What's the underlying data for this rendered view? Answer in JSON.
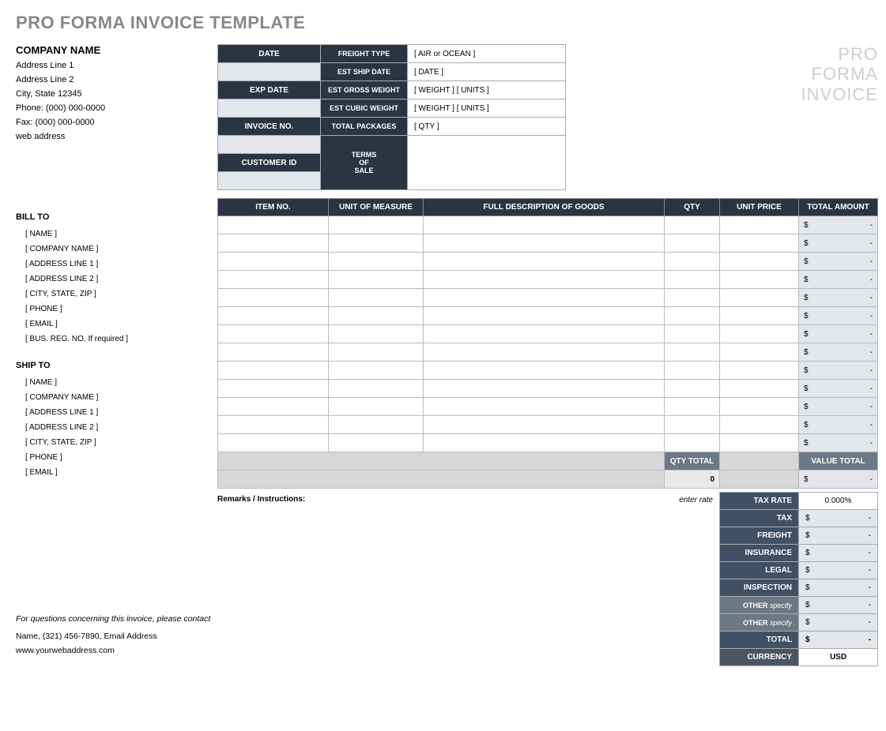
{
  "title": "PRO FORMA INVOICE TEMPLATE",
  "watermark": {
    "l1": "PRO",
    "l2": "FORMA",
    "l3": "INVOICE"
  },
  "company": {
    "name": "COMPANY NAME",
    "addr1": "Address Line 1",
    "addr2": "Address Line 2",
    "city": "City, State  12345",
    "phone": "Phone: (000) 000-0000",
    "fax": "Fax: (000) 000-0000",
    "web": "web address"
  },
  "info": {
    "date_lbl": "DATE",
    "freight_lbl": "FREIGHT TYPE",
    "freight_val": "[ AIR or OCEAN ]",
    "ship_lbl": "EST SHIP DATE",
    "ship_val": "[ DATE ]",
    "exp_lbl": "EXP DATE",
    "gross_lbl": "EST GROSS WEIGHT",
    "gross_val": "[ WEIGHT ]   [ UNITS ]",
    "cubic_lbl": "EST CUBIC WEIGHT",
    "cubic_val": "[ WEIGHT ]   [ UNITS ]",
    "inv_lbl": "INVOICE NO.",
    "pkg_lbl": "TOTAL PACKAGES",
    "pkg_val": "[ QTY ]",
    "cust_lbl": "CUSTOMER ID",
    "terms_l1": "TERMS",
    "terms_l2": "OF",
    "terms_l3": "SALE"
  },
  "billto": {
    "title": "BILL TO",
    "rows": [
      "[ NAME ]",
      "[ COMPANY NAME ]",
      "[ ADDRESS LINE 1 ]",
      "[ ADDRESS LINE 2 ]",
      "[ CITY, STATE, ZIP ]",
      "[ PHONE ]",
      "[ EMAIL ]",
      "[ BUS. REG. NO.  If required ]"
    ]
  },
  "shipto": {
    "title": "SHIP TO",
    "rows": [
      "[ NAME ]",
      "[ COMPANY NAME ]",
      "[ ADDRESS LINE 1 ]",
      "[ ADDRESS LINE 2 ]",
      "[ CITY, STATE, ZIP ]",
      "[ PHONE ]",
      "[ EMAIL ]"
    ]
  },
  "items_header": {
    "c1": "ITEM NO.",
    "c2": "UNIT OF MEASURE",
    "c3": "FULL DESCRIPTION OF GOODS",
    "c4": "QTY",
    "c5": "UNIT PRICE",
    "c6": "TOTAL AMOUNT"
  },
  "amt_cur": "$",
  "amt_dash": "-",
  "qty_total_lbl": "QTY TOTAL",
  "qty_total_val": "0",
  "value_total_lbl": "VALUE TOTAL",
  "remarks_lbl": "Remarks / Instructions:",
  "enter_rate": "enter rate",
  "summary": {
    "tax_rate_lbl": "TAX RATE",
    "tax_rate_val": "0.000%",
    "tax_lbl": "TAX",
    "freight_lbl": "FREIGHT",
    "ins_lbl": "INSURANCE",
    "legal_lbl": "LEGAL",
    "insp_lbl": "INSPECTION",
    "other1_lbl": "OTHER",
    "other1_sub": "specify",
    "other2_lbl": "OTHER",
    "other2_sub": "specify",
    "total_lbl": "TOTAL",
    "currency_lbl": "CURRENCY",
    "currency_val": "USD"
  },
  "footer": {
    "q": "For questions concerning this invoice, please contact",
    "contact": "Name, (321) 456-7890, Email Address",
    "web": "www.yourwebaddress.com"
  }
}
